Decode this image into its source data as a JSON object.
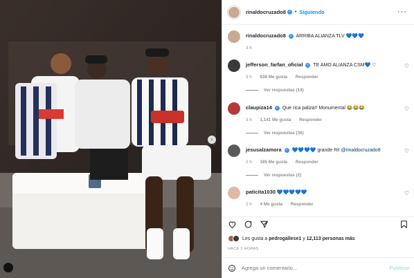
{
  "post": {
    "author": "rinaldocruzado8",
    "follow_label": "Siguiendo",
    "caption": "ARRIBA ALIANZA TLV 💙💙💙",
    "caption_time": "3 h"
  },
  "comments": [
    {
      "user": "jefferson_farfan_oficial",
      "text": "TE AMO ALIANZA CSM💙 ♡",
      "time": "3 h",
      "likes": "638 Me gusta",
      "reply": "Responder",
      "replies": "Ver respuestas (14)",
      "verified": true
    },
    {
      "user": "claupiza14",
      "text": "Que rica paliza!! Monumental 😂😂😂",
      "time": "3 h",
      "likes": "1,141 Me gusta",
      "reply": "Responder",
      "replies": "Ver respuestas (36)",
      "verified": true
    },
    {
      "user": "jesusalzamora",
      "text": "💙💙💙💙 grande Ri!",
      "mention": "@rinaldocruzado8",
      "time": "2 h",
      "likes": "185 Me gusta",
      "reply": "Responder",
      "replies": "Ver respuestas (2)",
      "verified": true
    },
    {
      "user": "paticita1030",
      "text": "💙💙💙💙💙",
      "time": "2 h",
      "likes": "4 Me gusta",
      "reply": "Responder",
      "verified": false
    }
  ],
  "likes": {
    "prefix": "Les gusta a",
    "first_user": "pedrogallese1",
    "connector": "y",
    "count": "12,113 personas más"
  },
  "date": "HACE 3 HORAS",
  "comment_box": {
    "placeholder": "Agrega un comentario...",
    "publish": "Publicar"
  },
  "colors": {
    "accent": "#0095f6",
    "verified": "#3897f0",
    "muted": "#8e8e8e"
  }
}
